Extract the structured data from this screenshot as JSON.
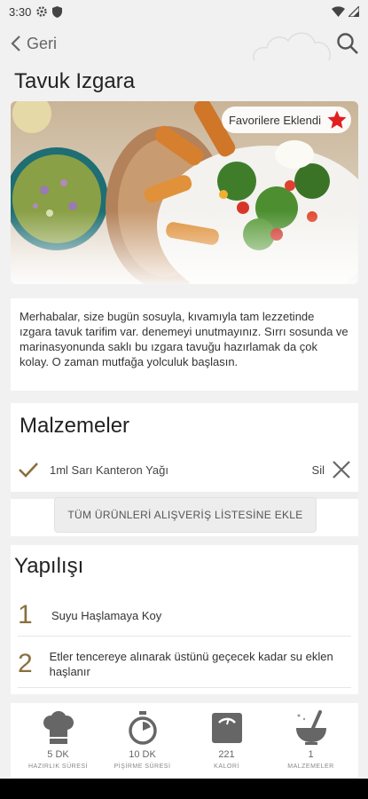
{
  "status": {
    "time": "3:30"
  },
  "header": {
    "back_label": "Geri"
  },
  "recipe": {
    "title": "Tavuk Izgara",
    "favorite_label": "Favorilere Eklendi",
    "description": "Merhabalar, size bugün sosuyla, kıvamıyla tam lezzetinde ızgara tavuk tarifim var. denemeyi unutmayınız. Sırrı sosunda ve marinasyonunda saklı bu ızgara tavuğu hazırlamak da çok kolay. O zaman mutfağa yolculuk başlasın."
  },
  "ingredients": {
    "heading": "Malzemeler",
    "items": [
      {
        "name": "1ml Sarı Kanteron Yağı",
        "delete_label": "Sil"
      }
    ],
    "add_all_label": "TÜM ÜRÜNLERİ ALIŞVERİŞ LİSTESİNE EKLE"
  },
  "steps": {
    "heading": "Yapılışı",
    "items": [
      {
        "number": "1",
        "text": "Suyu Haşlamaya Koy"
      },
      {
        "number": "2",
        "text": "Etler tencereye alınarak üstünü geçecek kadar su eklen haşlanır"
      }
    ]
  },
  "stats": [
    {
      "value": "5 DK",
      "label": "HAZIRLIK SÜRESİ",
      "icon": "chef-hat-icon"
    },
    {
      "value": "10 DK",
      "label": "PİŞİRME SÜRESİ",
      "icon": "stopwatch-icon"
    },
    {
      "value": "221",
      "label": "KALORİ",
      "icon": "scale-icon"
    },
    {
      "value": "1",
      "label": "MALZEMELER",
      "icon": "mortar-pestle-icon"
    }
  ],
  "colors": {
    "accent": "#8a6f3e",
    "favorite_star": "#e02020",
    "close": "#666666"
  }
}
